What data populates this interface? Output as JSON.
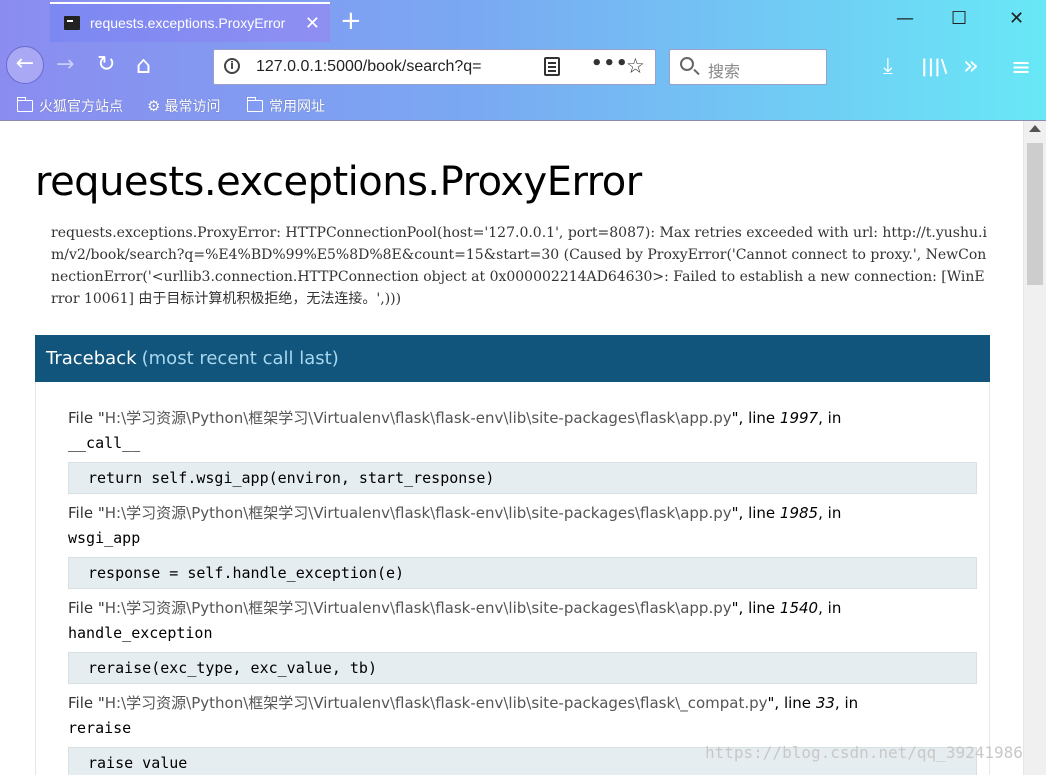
{
  "browser": {
    "tab_title": "requests.exceptions.ProxyError",
    "tab_close": "✕",
    "new_tab": "+",
    "window_minimize": "—",
    "window_maximize": "☐",
    "window_close": "✕",
    "url": "127.0.0.1:5000/book/search?q=",
    "url_more": "•••",
    "url_star": "☆",
    "search_placeholder": "搜索",
    "nav": {
      "back": "←",
      "forward": "→",
      "reload": "↻",
      "home": "⌂"
    },
    "tools": {
      "download": "⤓",
      "library": "|||\\",
      "overflow": "»",
      "menu": "≡"
    },
    "bookmarks": [
      "火狐官方站点",
      "最常访问",
      "常用网址"
    ]
  },
  "page": {
    "title": "requests.exceptions.ProxyError",
    "error_message": "requests.exceptions.ProxyError: HTTPConnectionPool(host='127.0.0.1', port=8087): Max retries exceeded with url: http://t.yushu.im/v2/book/search?q=%E4%BD%99%E5%8D%8E&count=15&start=30 (Caused by ProxyError('Cannot connect to proxy.', NewConnectionError('<urllib3.connection.HTTPConnection object at 0x000002214AD64630>: Failed to establish a new connection: [WinError 10061] 由于目标计算机积极拒绝，无法连接。',)))",
    "traceback_title": "Traceback",
    "traceback_subtitle": "(most recent call last)",
    "frames": [
      {
        "file_prefix": "File \"",
        "path": "H:\\学习资源\\Python\\框架学习\\Virtualenv\\flask\\flask-env\\lib\\site-packages\\flask\\app.py",
        "line_label": "\", line ",
        "lineno": "1997",
        "in_label": ", in",
        "func": "__call__",
        "code": "return self.wsgi_app(environ, start_response)"
      },
      {
        "file_prefix": "File \"",
        "path": "H:\\学习资源\\Python\\框架学习\\Virtualenv\\flask\\flask-env\\lib\\site-packages\\flask\\app.py",
        "line_label": "\", line ",
        "lineno": "1985",
        "in_label": ", in",
        "func": "wsgi_app",
        "code": "response = self.handle_exception(e)"
      },
      {
        "file_prefix": "File \"",
        "path": "H:\\学习资源\\Python\\框架学习\\Virtualenv\\flask\\flask-env\\lib\\site-packages\\flask\\app.py",
        "line_label": "\", line ",
        "lineno": "1540",
        "in_label": ", in",
        "func": "handle_exception",
        "code": "reraise(exc_type, exc_value, tb)"
      },
      {
        "file_prefix": "File \"",
        "path": "H:\\学习资源\\Python\\框架学习\\Virtualenv\\flask\\flask-env\\lib\\site-packages\\flask\\_compat.py",
        "line_label": "\", line ",
        "lineno": "33",
        "in_label": ", in",
        "func": "reraise",
        "code": "raise value"
      }
    ],
    "watermark": "https://blog.csdn.net/qq_39241986"
  }
}
